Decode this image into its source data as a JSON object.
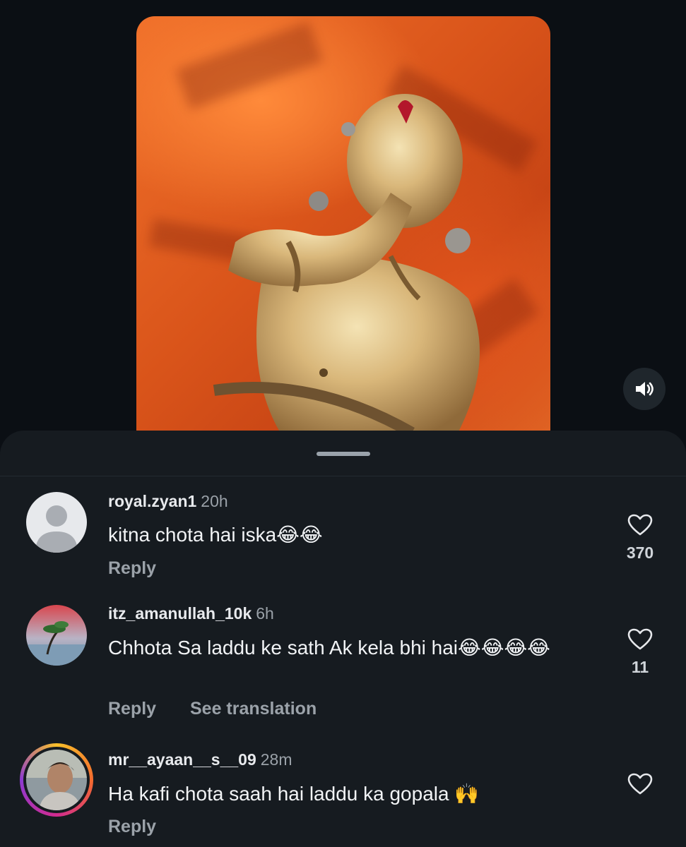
{
  "media": {
    "volume_icon": "speaker-icon"
  },
  "comments": [
    {
      "username": "royal.zyan1",
      "time": "20h",
      "text": "kitna chota hai iska😂😂",
      "reply_label": "Reply",
      "likes": "370"
    },
    {
      "username": "itz_amanullah_10k",
      "time": "6h",
      "text": "Chhota Sa laddu ke sath Ak kela bhi hai😂😂😂😂",
      "reply_label": "Reply",
      "translate_label": "See translation",
      "likes": "11"
    },
    {
      "username": "mr__ayaan__s__09",
      "time": "28m",
      "text": "Ha kafi chota saah hai laddu ka gopala 🙌",
      "reply_label": "Reply",
      "likes": ""
    }
  ]
}
